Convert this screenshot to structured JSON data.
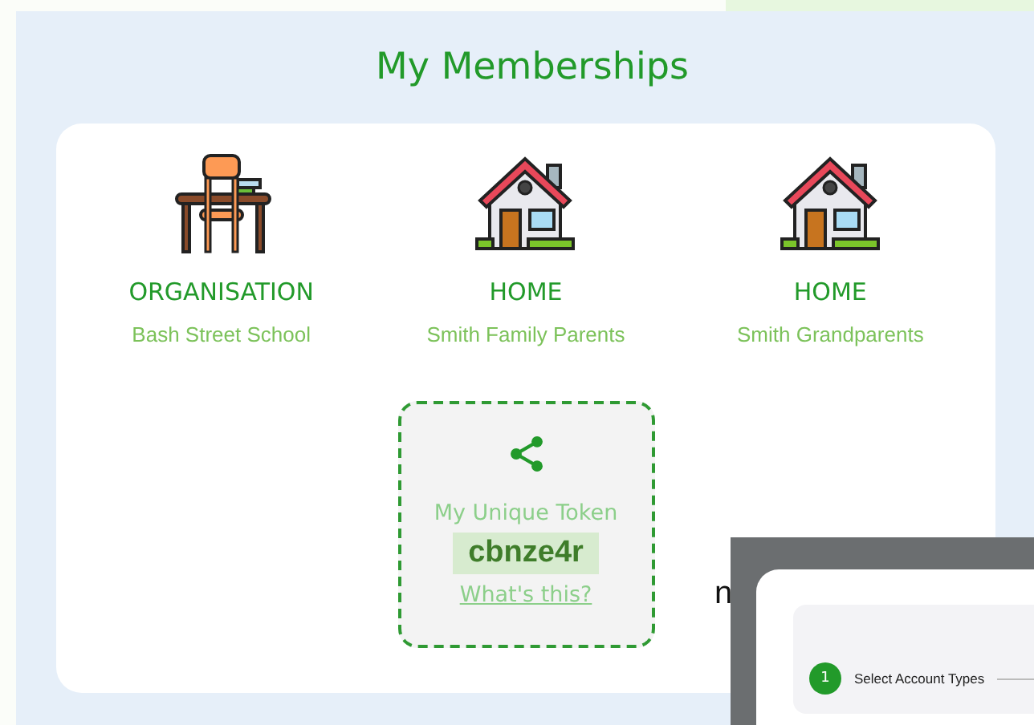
{
  "title": "My Memberships",
  "memberships": [
    {
      "kind": "organisation",
      "type": "ORGANISATION",
      "name": "Bash Street School"
    },
    {
      "kind": "home",
      "type": "HOME",
      "name": "Smith Family Parents"
    },
    {
      "kind": "home",
      "type": "HOME",
      "name": "Smith Grandparents"
    }
  ],
  "token": {
    "label": "My Unique Token",
    "value": "cbnze4r",
    "link": "What's this?"
  },
  "overlay": {
    "partial_text": "n",
    "steps": [
      {
        "number": "1",
        "label": "Select Account Types",
        "selected": true
      }
    ]
  }
}
